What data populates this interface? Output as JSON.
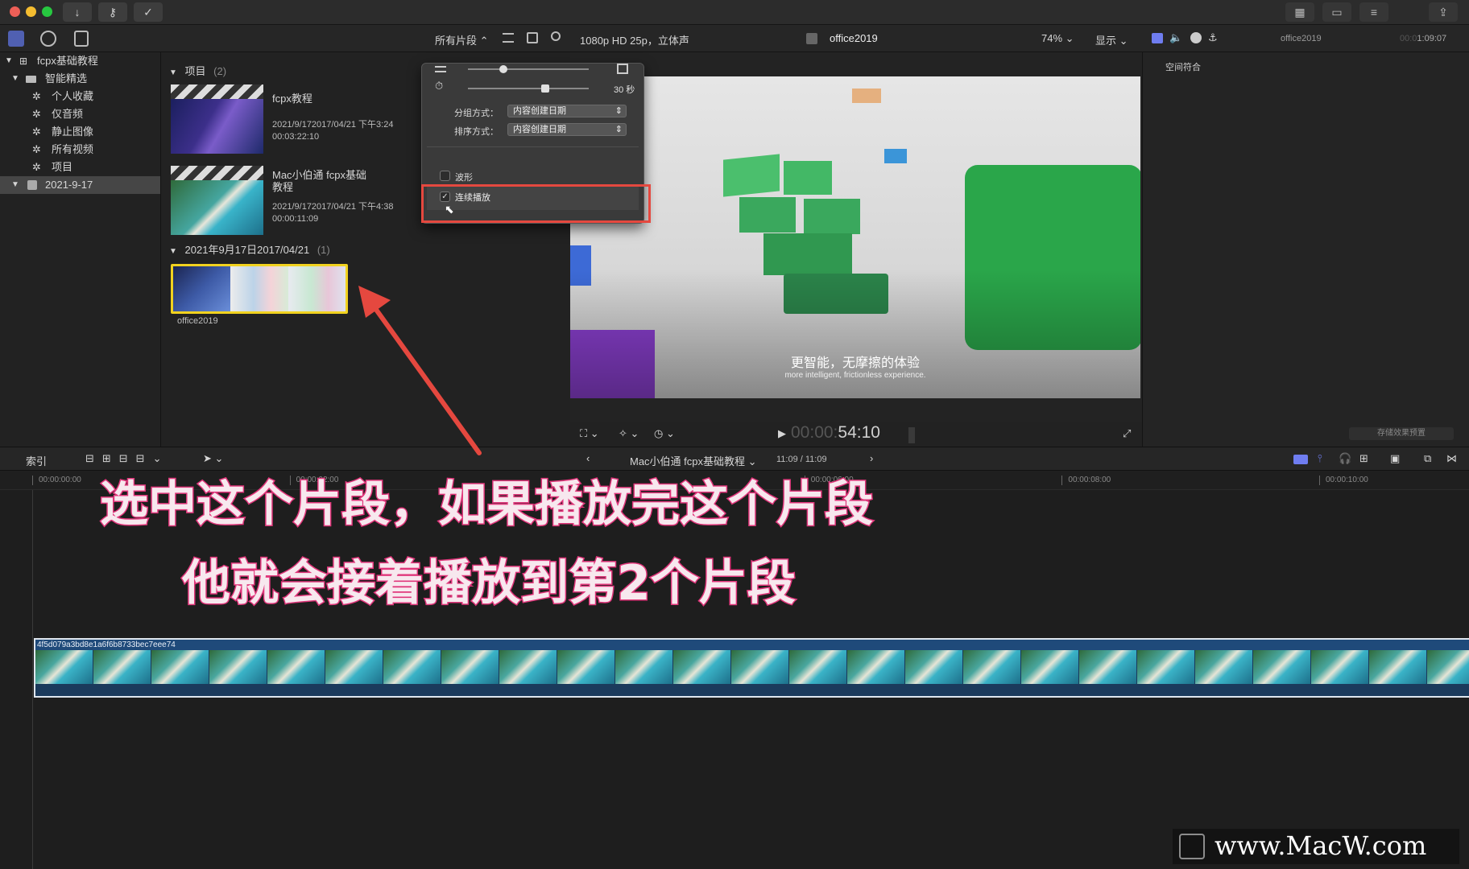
{
  "window": {
    "toolbar_icons": [
      "download-icon",
      "key-icon",
      "checkmark-circle-icon"
    ],
    "right_icons": [
      "grid-view-icon",
      "browser-layout-icon",
      "inspector-layout-icon",
      "share-icon"
    ]
  },
  "browser_toolbar": {
    "filter_label": "所有片段 ⌃",
    "icons": [
      "list-view-icon",
      "clip-appearance-icon",
      "search-icon"
    ]
  },
  "sidebar": {
    "items": [
      {
        "label": "fcpx基础教程",
        "level": 0
      },
      {
        "label": "智能精选",
        "level": 1
      },
      {
        "label": "个人收藏",
        "level": 2
      },
      {
        "label": "仅音频",
        "level": 2
      },
      {
        "label": "静止图像",
        "level": 2
      },
      {
        "label": "所有视频",
        "level": 2
      },
      {
        "label": "项目",
        "level": 2
      },
      {
        "label": "2021-9-17",
        "level": 0
      }
    ]
  },
  "browser": {
    "projects_header": "项目",
    "projects_count": "(2)",
    "projects": [
      {
        "name": "fcpx教程",
        "date": "2021/9/172017/04/21 下午3:24",
        "duration": "00:03:22:10"
      },
      {
        "name": "Mac小伯通 fcpx基础\n教程",
        "date": "2021/9/172017/04/21 下午4:38",
        "duration": "00:00:11:09"
      }
    ],
    "event_header": "2021年9月17日2017/04/21",
    "event_count": "(1)",
    "clip_name": "office2019"
  },
  "popover": {
    "duration_label": "30 秒",
    "group_label": "分组方式：",
    "group_value": "内容创建日期",
    "sort_label": "排序方式：",
    "sort_value": "内容创建日期",
    "waveform_label": "波形",
    "continuous_label": "连续播放",
    "continuous_checked": "✓"
  },
  "viewer": {
    "format": "1080p HD 25p，立体声",
    "title": "office2019",
    "zoom": "74% ⌄",
    "display": "显示 ⌄",
    "caption_cn": "更智能，无摩擦的体验",
    "caption_en": "more intelligent, frictionless experience.",
    "timecode_dim": "00:00:",
    "timecode": "54:10"
  },
  "inspector": {
    "title": "office2019",
    "timecode_dim": "00:0",
    "timecode": "1:09:07",
    "section": "空间符合",
    "save_preset": "存储效果预置"
  },
  "timeline_bar": {
    "index": "索引",
    "project": "Mac小伯通 fcpx基础教程 ⌄",
    "position": "11:09 / 11:09"
  },
  "ruler": {
    "marks": [
      {
        "label": "00:00:00:00",
        "at": 0.0
      },
      {
        "label": "00:00:02:00",
        "at": 0.2
      },
      {
        "label": "00:00:06:00",
        "at": 0.6
      },
      {
        "label": "00:00:08:00",
        "at": 0.8
      },
      {
        "label": "00:00:10:00",
        "at": 1.0
      }
    ]
  },
  "timeline": {
    "clip_id": "4f5d079a3bd8e1a6f6b8733bec7eee74"
  },
  "annotation": {
    "line1": "选中这个片段，如果播放完这个片段",
    "line2": "他就会接着播放到第2个片段"
  },
  "watermark": "www.MacW.com",
  "colors": {
    "accent_red": "#e5483f",
    "annotation_pink": "#e0357a",
    "selection_yellow": "#f1d21f",
    "clip_border": "#dfe6ee",
    "clip_label_bg": "#1f4a7a"
  }
}
